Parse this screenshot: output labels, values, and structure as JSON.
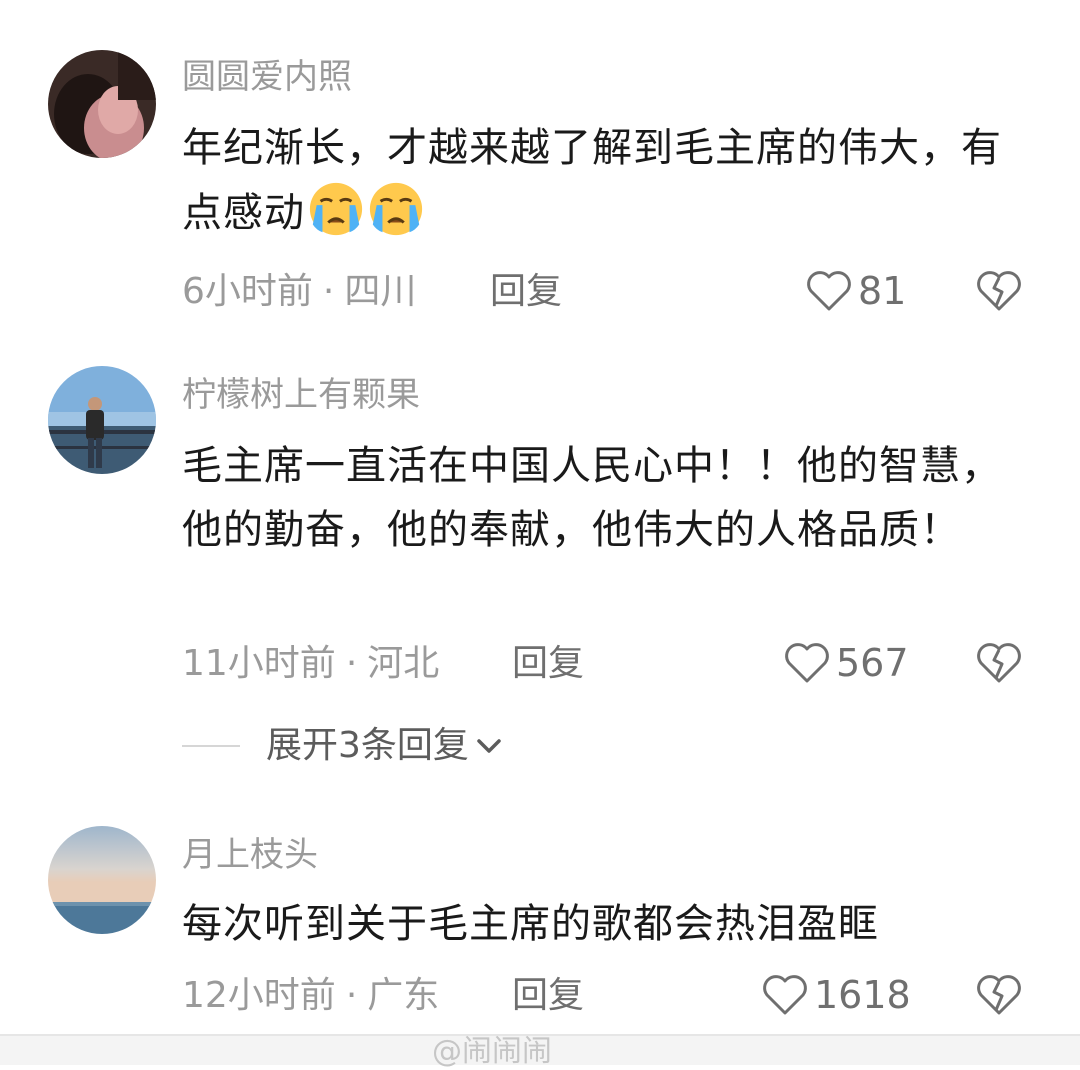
{
  "comments": [
    {
      "username": "圆圆爱内照",
      "text": "年纪渐长，才越来越了解到毛主席的伟大，有点感动",
      "emoji": [
        "loudly-crying-face-icon",
        "loudly-crying-face-icon"
      ],
      "time": "6小时前",
      "location": "四川",
      "reply": "回复",
      "likes": "81"
    },
    {
      "username": "柠檬树上有颗果",
      "text": "毛主席一直活在中国人民心中！！他的智慧，他的勤奋，他的奉献，他伟大的人格品质！",
      "time": "11小时前",
      "location": "河北",
      "reply": "回复",
      "likes": "567",
      "expand_replies": "展开3条回复"
    },
    {
      "username": "月上枝头",
      "text": "每次听到关于毛主席的歌都会热泪盈眶",
      "time": "12小时前",
      "location": "广东",
      "reply": "回复",
      "likes": "1618"
    }
  ],
  "separator": "·",
  "watermark": "@闹闹闹"
}
